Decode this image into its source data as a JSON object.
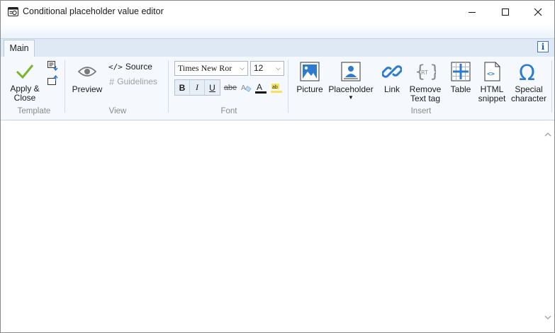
{
  "window": {
    "title": "Conditional placeholder value editor"
  },
  "tabs": [
    {
      "label": "Main"
    }
  ],
  "info_button": {
    "label": "i"
  },
  "ribbon": {
    "groups": {
      "template": "Template",
      "view": "View",
      "font": "Font",
      "insert": "Insert"
    },
    "template": {
      "apply_close_line1": "Apply &",
      "apply_close_line2": "Close"
    },
    "view": {
      "preview": "Preview",
      "source": "Source",
      "guidelines": "Guidelines"
    },
    "font": {
      "family": "Times New Ror",
      "size": "12",
      "bold": "B",
      "italic": "I",
      "underline": "U",
      "strikethrough": "abe"
    },
    "insert": {
      "picture": "Picture",
      "placeholder": "Placeholder",
      "link": "Link",
      "remove_text_tag_line1": "Remove",
      "remove_text_tag_line2": "Text tag",
      "table": "Table",
      "html_snippet_line1": "HTML",
      "html_snippet_line2": "snippet",
      "special_character_line1": "Special",
      "special_character_line2": "character",
      "rt_label": "RT"
    }
  },
  "colors": {
    "accent": "#2c7bd1",
    "check": "#7ab62d",
    "ribbon_bg": "#f5f8fc",
    "group_label": "#8a8a8a"
  },
  "icons": {
    "app": "editor-window-icon",
    "apply": "checkmark-icon",
    "preview": "eye-icon",
    "source": "code-brackets-icon",
    "guidelines": "hash-grid-icon",
    "picture": "picture-icon",
    "placeholder": "person-placeholder-icon",
    "link": "chain-link-icon",
    "remove_text_tag": "rt-braces-icon",
    "table": "table-grid-icon",
    "html_snippet": "html-file-icon",
    "special_character": "omega-icon"
  }
}
